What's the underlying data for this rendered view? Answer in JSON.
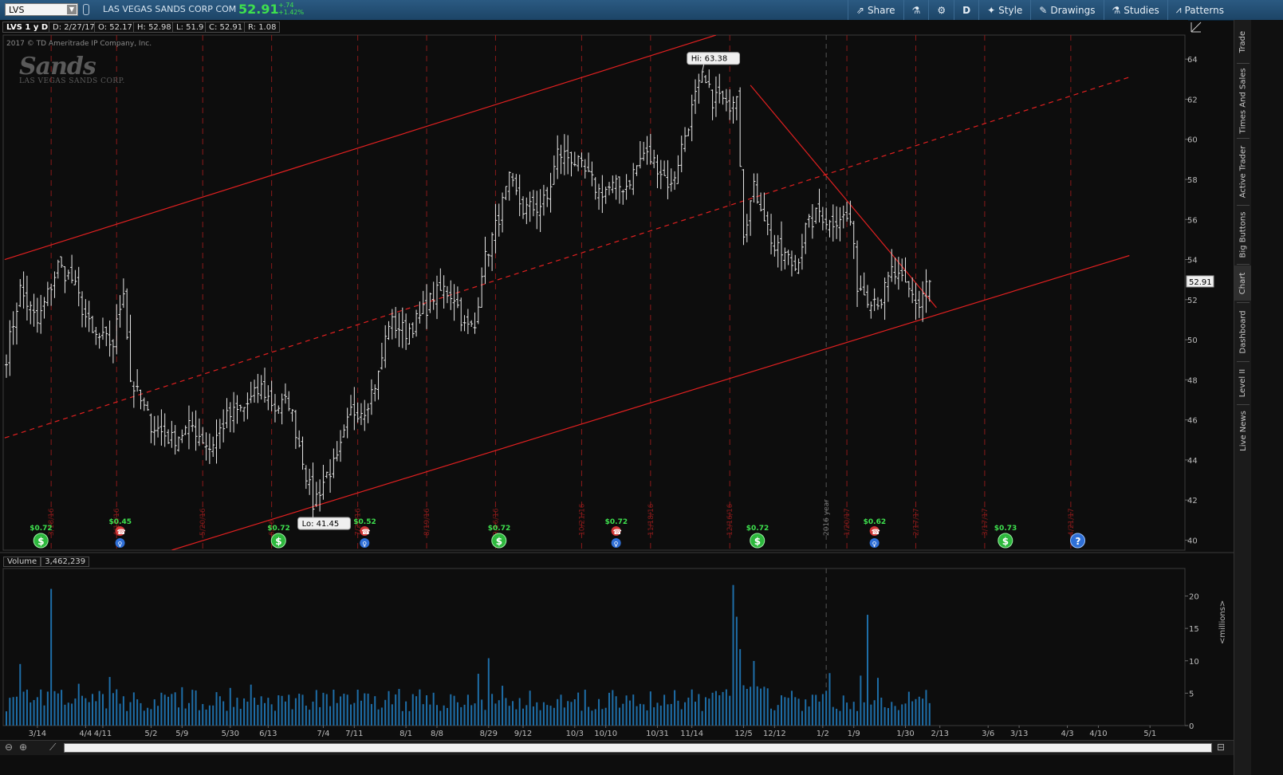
{
  "topbar": {
    "symbol": "LVS",
    "description": "LAS VEGAS SANDS CORP COM",
    "last": "52.91",
    "change": "+.74",
    "change_pct": "+1.42%",
    "buttons": [
      {
        "id": "share",
        "label": "Share",
        "icon": "share-icon"
      },
      {
        "id": "lab",
        "label": "",
        "icon": "flask-icon"
      },
      {
        "id": "settings",
        "label": "",
        "icon": "gear-icon"
      },
      {
        "id": "aggregation",
        "label": "D",
        "icon": ""
      },
      {
        "id": "style",
        "label": "Style",
        "icon": "style-icon"
      },
      {
        "id": "drawings",
        "label": "Drawings",
        "icon": "pencil-icon"
      },
      {
        "id": "studies",
        "label": "Studies",
        "icon": "flask-icon"
      },
      {
        "id": "patterns",
        "label": "Patterns",
        "icon": "patterns-icon"
      }
    ]
  },
  "infobar": {
    "symbol_period": "LVS 1 y D",
    "date": "D: 2/27/17",
    "open": "O: 52.17",
    "high": "H: 52.98",
    "low": "L: 51.9",
    "close": "C: 52.91",
    "range": "R: 1.08"
  },
  "watermark": {
    "copyright": "2017 © TD Ameritrade IP Company, Inc.",
    "logo": "Sands",
    "logo_sub": "LAS VEGAS SANDS CORP."
  },
  "sidebar": {
    "items": [
      {
        "label": "Trade",
        "active": false
      },
      {
        "label": "Times And Sales",
        "active": false
      },
      {
        "label": "Active Trader",
        "active": false
      },
      {
        "label": "Big Buttons",
        "active": false
      },
      {
        "label": "Chart",
        "active": true
      },
      {
        "label": "Dashboard",
        "active": false
      },
      {
        "label": "Level II",
        "active": false
      },
      {
        "label": "Live News",
        "active": false
      }
    ]
  },
  "volume": {
    "label": "Volume",
    "value": "3,462,239",
    "unit_label": "<millions>"
  },
  "chart_data": [
    {
      "type": "ohlc",
      "title": "LVS 1 y D",
      "ylim": [
        39.5,
        65.2
      ],
      "yticks": [
        40,
        42,
        44,
        46,
        48,
        50,
        52,
        54,
        56,
        58,
        60,
        62,
        64
      ],
      "last_price_label": "52.91",
      "hi_label": "Hi: 63.38",
      "lo_label": "Lo: 41.45",
      "year_marker": "2016 year",
      "x_labels": [
        "3/14",
        "4/4",
        "4/11",
        "5/2",
        "5/9",
        "5/30",
        "6/13",
        "7/4",
        "7/11",
        "8/1",
        "8/8",
        "8/29",
        "9/12",
        "10/3",
        "10/10",
        "10/31",
        "11/14",
        "12/5",
        "12/12",
        "1/2",
        "1/9",
        "1/30",
        "2/13",
        "3/6",
        "3/13",
        "4/3",
        "4/10",
        "5/1"
      ],
      "x_label_index": [
        9,
        23,
        28,
        42,
        51,
        65,
        76,
        92,
        101,
        116,
        125,
        140,
        150,
        165,
        174,
        189,
        199,
        214,
        223,
        237,
        246,
        261,
        271,
        285,
        294,
        308,
        317,
        332
      ],
      "event_lines": [
        {
          "date": "3/18/16",
          "i": 13
        },
        {
          "date": "4/15/16",
          "i": 32
        },
        {
          "date": "5/20/16",
          "i": 57
        },
        {
          "date": "6/16",
          "i": 77
        },
        {
          "date": "7/22/16",
          "i": 102
        },
        {
          "date": "8/19/16",
          "i": 122
        },
        {
          "date": "9/16/16",
          "i": 142
        },
        {
          "date": "10/21/16",
          "i": 167
        },
        {
          "date": "11/18/16",
          "i": 187
        },
        {
          "date": "12/16/16",
          "i": 210
        },
        {
          "date": "1/20/17",
          "i": 244
        },
        {
          "date": "2/17/17",
          "i": 264
        },
        {
          "date": "3/17/17",
          "i": 284
        },
        {
          "date": "4/21/17",
          "i": 309
        }
      ],
      "events": [
        {
          "type": "dividend",
          "i": 10,
          "amount": "$0.72"
        },
        {
          "type": "earnings",
          "i": 33,
          "amount": "$0.45"
        },
        {
          "type": "dividend",
          "i": 79,
          "amount": "$0.72"
        },
        {
          "type": "earnings",
          "i": 104,
          "amount": "$0.52"
        },
        {
          "type": "dividend",
          "i": 143,
          "amount": "$0.72"
        },
        {
          "type": "earnings",
          "i": 177,
          "amount": "$0.72"
        },
        {
          "type": "dividend",
          "i": 218,
          "amount": "$0.72"
        },
        {
          "type": "earnings",
          "i": 252,
          "amount": "$0.62"
        },
        {
          "type": "dividend",
          "i": 290,
          "amount": "$0.73"
        },
        {
          "type": "unknown",
          "i": 311,
          "amount": ""
        }
      ],
      "trendlines": [
        {
          "style": "solid",
          "from": [
            -0.5,
            54.0
          ],
          "to": [
            206,
            65.2
          ]
        },
        {
          "style": "dashed",
          "from": [
            -0.5,
            45.1
          ],
          "to": [
            326,
            63.1
          ]
        },
        {
          "style": "solid",
          "from": [
            48,
            39.5
          ],
          "to": [
            326,
            54.2
          ]
        },
        {
          "style": "solid",
          "from": [
            216,
            62.7
          ],
          "to": [
            270,
            51.6
          ]
        }
      ],
      "anchors": [
        [
          0,
          49.2
        ],
        [
          4,
          52.5
        ],
        [
          9,
          50.8
        ],
        [
          15,
          53.7
        ],
        [
          19,
          53.0
        ],
        [
          25,
          50.2
        ],
        [
          31,
          49.8
        ],
        [
          34,
          52.6
        ],
        [
          36,
          48.0
        ],
        [
          42,
          45.8
        ],
        [
          48,
          45.0
        ],
        [
          54,
          45.7
        ],
        [
          59,
          44.6
        ],
        [
          64,
          46.1
        ],
        [
          69,
          46.6
        ],
        [
          74,
          47.6
        ],
        [
          78,
          46.6
        ],
        [
          82,
          46.9
        ],
        [
          86,
          44.1
        ],
        [
          89,
          41.8
        ],
        [
          93,
          43.3
        ],
        [
          96,
          43.9
        ],
        [
          100,
          46.4
        ],
        [
          104,
          46.6
        ],
        [
          108,
          48.2
        ],
        [
          111,
          50.9
        ],
        [
          116,
          50.4
        ],
        [
          120,
          51.1
        ],
        [
          124,
          52.2
        ],
        [
          127,
          52.5
        ],
        [
          130,
          52.2
        ],
        [
          133,
          50.6
        ],
        [
          136,
          50.6
        ],
        [
          138,
          53.5
        ],
        [
          142,
          55.6
        ],
        [
          146,
          57.9
        ],
        [
          150,
          56.5
        ],
        [
          154,
          56.6
        ],
        [
          157,
          57.0
        ],
        [
          160,
          59.3
        ],
        [
          164,
          59.1
        ],
        [
          168,
          58.3
        ],
        [
          172,
          57.4
        ],
        [
          176,
          57.6
        ],
        [
          180,
          57.7
        ],
        [
          185,
          59.3
        ],
        [
          189,
          58.7
        ],
        [
          193,
          57.6
        ],
        [
          196,
          59.6
        ],
        [
          200,
          62.1
        ],
        [
          202,
          63.0
        ],
        [
          205,
          62.0
        ],
        [
          207,
          62.2
        ],
        [
          209,
          61.5
        ],
        [
          212,
          62.5
        ],
        [
          214,
          55.5
        ],
        [
          217,
          57.5
        ],
        [
          219,
          56.8
        ],
        [
          221,
          55.6
        ],
        [
          223,
          54.5
        ],
        [
          226,
          54.2
        ],
        [
          229,
          53.6
        ],
        [
          232,
          55.5
        ],
        [
          236,
          56.4
        ],
        [
          239,
          55.8
        ],
        [
          242,
          56.2
        ],
        [
          245,
          55.9
        ],
        [
          247,
          52.8
        ],
        [
          250,
          52.2
        ],
        [
          254,
          52.0
        ],
        [
          257,
          53.4
        ],
        [
          260,
          52.8
        ],
        [
          263,
          52.2
        ],
        [
          265,
          51.7
        ],
        [
          267,
          52.9
        ]
      ],
      "last_bar": {
        "i": 268,
        "open": 52.17,
        "high": 52.98,
        "low": 51.9,
        "close": 52.91
      }
    },
    {
      "type": "bar",
      "title": "Volume",
      "ylabel": "<millions>",
      "ylim": [
        0,
        24
      ],
      "yticks": [
        0,
        5,
        10,
        15,
        20
      ],
      "latest": 3.462239,
      "spikes": [
        [
          13,
          21.1
        ],
        [
          211,
          21.7
        ],
        [
          212,
          16.8
        ],
        [
          250,
          17.1
        ],
        [
          30,
          7.5
        ],
        [
          213,
          9.8
        ],
        [
          140,
          10.4
        ],
        [
          4,
          9.5
        ]
      ]
    }
  ]
}
